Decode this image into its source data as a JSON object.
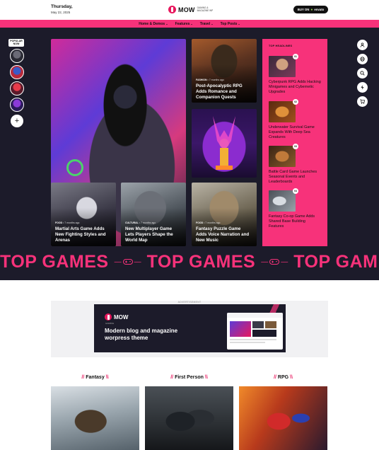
{
  "header": {
    "day": "Thursday,",
    "date": "May 22, 2025",
    "logo_text": "MOW",
    "logo_tagline": "GAMING & MAGAZINE WP",
    "buy_label": "BUY ON",
    "buy_brand": "envato"
  },
  "nav": [
    {
      "label": "Home & Demos"
    },
    {
      "label": "Features"
    },
    {
      "label": "Travel"
    },
    {
      "label": "Top Posts"
    }
  ],
  "left_rail": {
    "popular_label": "POPULAR NOW",
    "add_label": "+"
  },
  "right_rail": [
    "user-icon",
    "globe-icon",
    "search-icon",
    "bolt-icon",
    "cart-icon"
  ],
  "hero": {
    "cards": [
      {
        "category": "FASHION",
        "time": "7 months ago",
        "title": "Post-Apocalyptic RPG Adds Romance and Companion Quests"
      },
      {
        "category": "FOOD",
        "time": "7 months ago",
        "title": "Martial Arts Game Adds New Fighting Styles and Arenas"
      },
      {
        "category": "CULTURAL",
        "time": "7 months ago",
        "title": "New Multiplayer Game Lets Players Shape the World Map"
      },
      {
        "category": "FOOD",
        "time": "7 months ago",
        "title": "Fantasy Puzzle Game Adds Voice Narration and New Music"
      }
    ],
    "top_headlines": {
      "title": "TOP HEADLINES",
      "items": [
        {
          "num": "01",
          "title": "Cyberpunk RPG Adds Hacking Minigames and Cybernetic Upgrades"
        },
        {
          "num": "02",
          "title": "Underwater Survival Game Expands With Deep Sea Creatures"
        },
        {
          "num": "03",
          "title": "Battle Card Game Launches Seasonal Events and Leaderboards"
        },
        {
          "num": "04",
          "title": "Fantasy Co-op Game Adds Shared Base Building Features"
        }
      ]
    },
    "marquee": [
      "TOP GAMES",
      "TOP GAMES",
      "TOP GAME"
    ]
  },
  "ad": {
    "label": "ADVERTISEMENT",
    "logo_text": "MOW",
    "logo_tag": "GAMING",
    "headline": "Modern blog and magazine worpress theme"
  },
  "categories": [
    {
      "name": "Fantasy"
    },
    {
      "name": "First Person"
    },
    {
      "name": "RPG"
    }
  ],
  "colors": {
    "accent": "#f7327a",
    "dark_bg": "#1c1b2a"
  }
}
